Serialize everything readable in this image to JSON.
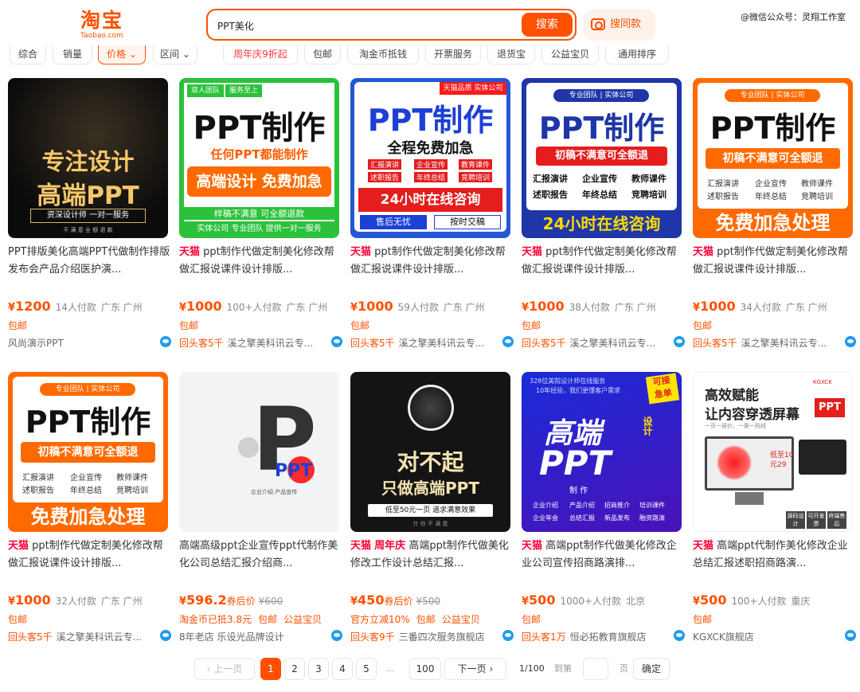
{
  "header": {
    "logo_cn": "淘宝",
    "logo_en": "Taobao.com",
    "search_value": "PPT美化",
    "search_button": "搜索",
    "same_image": "搜同款",
    "watermark": "@微信公众号：灵翔工作室"
  },
  "filters": [
    "综合",
    "销量",
    "价格",
    "区间",
    "周年庆9折起",
    "包邮",
    "淘金币抵钱",
    "开票服务",
    "退货宝",
    "公益宝贝",
    "通用排序"
  ],
  "colors": {
    "accent": "#ff5000",
    "tmall": "#ff0036"
  },
  "products": [
    {
      "thumb": {
        "l1": "专注设计",
        "l2": "高端PPT",
        "l3": "资深设计师 一对一服务",
        "l4": "不 满 意 全 额 退 款"
      },
      "title_pre": "",
      "title_mid": "PPT排版美化高端PPT代做制作排版发布会产品介绍医护演...",
      "price": "1200",
      "sold": "14人付款",
      "loc": "广东 广州",
      "tags": [
        "包邮"
      ],
      "rep": "",
      "shop": "风尚演示PPT"
    },
    {
      "thumb": {
        "b1": "双人团队",
        "b2": "服务至上",
        "l1": "PPT制作",
        "l2": "任何PPT都能制作",
        "l3": "高端设计 免费加急",
        "l4": "样稿不满意 可全额退款",
        "l5": "实体公司 专业团队 提供一对一服务"
      },
      "title_pre": "天猫",
      "title_mid": "ppt制作代做定制美化修改帮做汇报说课件设计排版...",
      "price": "1000",
      "sold": "100+人付款",
      "loc": "广东 广州",
      "tags": [
        "包邮"
      ],
      "rep": "回头客5千",
      "shop": "溪之擎美科讯云专..."
    },
    {
      "thumb": {
        "b1": "天猫品质",
        "b2": "实体公司",
        "l1": "PPT制作",
        "l2": "全程免费加急",
        "k1": "汇报演讲",
        "k2": "企业宣传",
        "k3": "教育课件",
        "k4": "述职报告",
        "k5": "年终总结",
        "k6": "竞聘培训",
        "l3": "24小时在线咨询",
        "l4": "售后无忧",
        "l5": "按时交稿"
      },
      "title_pre": "天猫",
      "title_mid": "ppt制作代做定制美化修改帮做汇报说课件设计排版...",
      "price": "1000",
      "sold": "59人付款",
      "loc": "广东 广州",
      "tags": [
        "包邮"
      ],
      "rep": "回头客5千",
      "shop": "溪之擎美科讯云专..."
    },
    {
      "thumb": {
        "b1": "专业团队",
        "b2": "实体公司",
        "l1": "PPT制作",
        "l2": "初稿不满意可全额退",
        "k1": "汇报演讲",
        "k2": "企业宣传",
        "k3": "教师课件",
        "k4": "述职报告",
        "k5": "年终总结",
        "k6": "竞聘培训",
        "l3": "24小时在线咨询"
      },
      "title_pre": "天猫",
      "title_mid": "ppt制作代做定制美化修改帮做汇报说课件设计排版...",
      "price": "1000",
      "sold": "38人付款",
      "loc": "广东 广州",
      "tags": [
        "包邮"
      ],
      "rep": "回头客5千",
      "shop": "溪之擎美科讯云专..."
    },
    {
      "thumb": {
        "b1": "专业团队",
        "b2": "实体公司",
        "l1": "PPT制作",
        "l2": "初稿不满意可全额退",
        "k1": "汇报演讲",
        "k2": "企业宣传",
        "k3": "教师课件",
        "k4": "述职报告",
        "k5": "年终总结",
        "k6": "竞聘培训",
        "l3": "免费加急处理"
      },
      "title_pre": "天猫",
      "title_mid": "ppt制作代做定制美化修改帮做汇报说课件设计排版...",
      "price": "1000",
      "sold": "34人付款",
      "loc": "广东 广州",
      "tags": [
        "包邮"
      ],
      "rep": "回头客5千",
      "shop": "溪之擎美科讯云专..."
    },
    {
      "thumb": {
        "b1": "专业团队",
        "b2": "实体公司",
        "l1": "PPT制作",
        "l2": "初稿不满意可全额退",
        "k1": "汇报演讲",
        "k2": "企业宣传",
        "k3": "教师课件",
        "k4": "述职报告",
        "k5": "年终总结",
        "k6": "竞聘培训",
        "l3": "免费加急处理"
      },
      "title_pre": "天猫",
      "title_mid": "ppt制作代做定制美化修改帮做汇报说课件设计排版...",
      "price": "1000",
      "sold": "32人付款",
      "loc": "广东 广州",
      "tags": [
        "包邮"
      ],
      "rep": "回头客5千",
      "shop": "溪之擎美科讯云专..."
    },
    {
      "thumb": {
        "l1": "P",
        "l2": "PPT",
        "l3": "企业介绍·产品宣传"
      },
      "title_pre": "",
      "title_mid": "高端高级ppt企业宣传ppt代制作美化公司总结汇报介绍商...",
      "price": "596.2",
      "voucher": "券后价",
      "orig": "¥600",
      "sold": "",
      "loc": "",
      "tags": [
        "淘金币已抵3.8元",
        "包邮",
        "公益宝贝"
      ],
      "rep": "",
      "shop": "8年老店 乐设光品牌设计"
    },
    {
      "thumb": {
        "l1": "对不起",
        "l2": "只做高端PPT",
        "l3": "低至50元一页 追求满意效果",
        "l4": "什 你 不 满 意"
      },
      "title_pre": "天猫",
      "title_pre2": "周年庆",
      "title_mid": "高端ppt制作代做美化修改工作设计总结汇报...",
      "price": "450",
      "voucher": "券后价",
      "orig": "¥500",
      "sold": "",
      "loc": "",
      "tags": [
        "官方立减10%",
        "包邮",
        "公益宝贝"
      ],
      "rep": "回头客9千",
      "shop": "三番四次服务旗舰店"
    },
    {
      "thumb": {
        "l0": "328位美院设计师在线服务",
        "l00": "10年经验，我们更懂客户需求",
        "b1": "可接",
        "b2": "急单",
        "l1": "高端",
        "l2": "PPT",
        "l3": "设计",
        "l4": "制 作",
        "k1": "企业介绍",
        "k2": "产品介绍",
        "k3": "招商推介",
        "k4": "培训课件",
        "k5": "企业年会",
        "k6": "总结汇报",
        "k7": "新品发布",
        "k8": "融资路演"
      },
      "title_pre": "天猫",
      "title_mid": "高端ppt制作代做美化修改企业公司宣传招商路演排...",
      "price": "500",
      "sold": "1000+人付款",
      "loc": "北京",
      "tags": [
        "包邮"
      ],
      "rep": "回头客1万",
      "shop": "恒必拓教育旗舰店"
    },
    {
      "thumb": {
        "l1": "高效赋能",
        "l2": "让内容穿透屏幕",
        "l3": "一页一报价，一案一档线",
        "l4": "KGXCK",
        "l5": "PPT",
        "k1": "低至10",
        "k2": "元29",
        "k3": "源码设计",
        "k4": "可开发票",
        "k5": "终端售后"
      },
      "title_pre": "天猫",
      "title_mid": "高端ppt代制作美化修改企业总结汇报述职招商路演...",
      "price": "500",
      "sold": "100+人付款",
      "loc": "重庆",
      "tags": [
        "包邮"
      ],
      "rep": "",
      "shop": "KGXCK旗舰店"
    }
  ],
  "pager": {
    "prev": "上一页",
    "pages": [
      "1",
      "2",
      "3",
      "4",
      "5"
    ],
    "ellipsis": "...",
    "last": "100",
    "next": "下一页",
    "total": "1/100",
    "goto": "到第",
    "page_unit": "页",
    "confirm": "确定"
  }
}
